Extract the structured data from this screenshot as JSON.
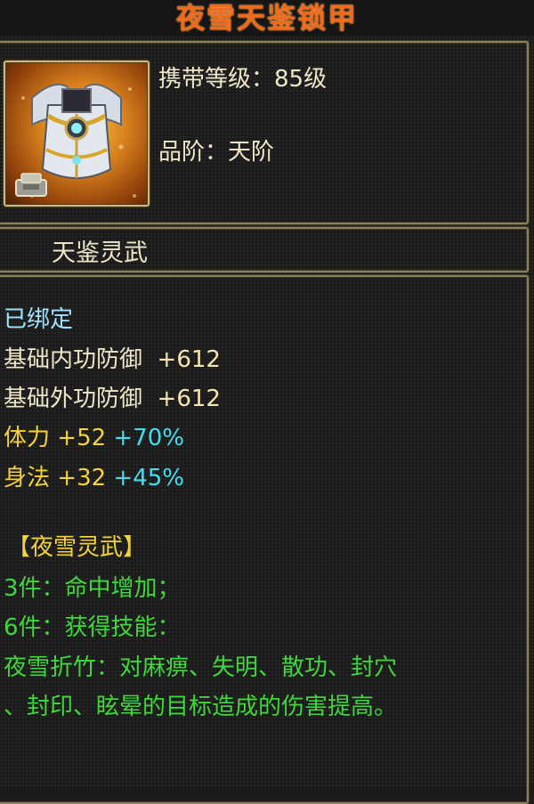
{
  "title": "夜雪天鉴锁甲",
  "item": {
    "icon": "armor-chestplate-icon",
    "bind_icon": "bind-pedestal-icon",
    "level_label": "携带等级：",
    "level_value": "85级",
    "grade_label": "品阶：",
    "grade_value": "天阶"
  },
  "set_name": "天鉴灵武",
  "bound_status": "已绑定",
  "stats": [
    {
      "name": "基础内功防御",
      "value": "+612"
    },
    {
      "name": "基础外功防御",
      "value": "+612"
    },
    {
      "name": "体力",
      "value": "+52",
      "bonus": "+70%"
    },
    {
      "name": "身法",
      "value": "+32",
      "bonus": "+45%"
    }
  ],
  "set_bonus": {
    "name": "【夜雪灵武】",
    "lines": [
      "3件：命中增加；",
      "6件：获得技能：",
      "夜雪折竹：对麻痹、失明、散功、封穴",
      "、封印、眩晕的目标造成的伤害提高。"
    ]
  },
  "colors": {
    "title": "#f06a1a",
    "bound": "#9fe3ff",
    "attr_yellow": "#f3d23a",
    "bonus_percent": "#3ee0f0",
    "set_green": "#3fd83a",
    "frame": "#8a8158"
  }
}
